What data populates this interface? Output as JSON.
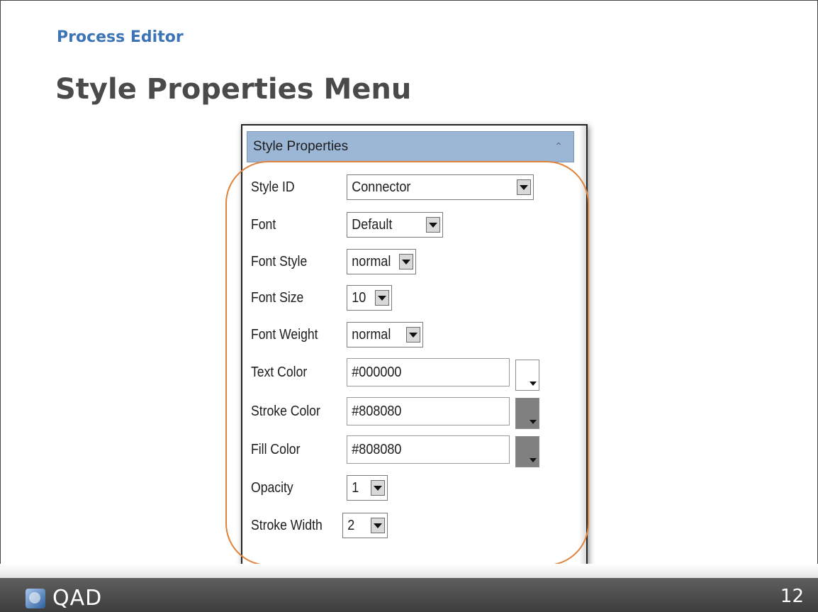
{
  "slide": {
    "kicker": "Process Editor",
    "title": "Style Properties Menu",
    "page_number": "12",
    "logo_text": "QAD"
  },
  "panel": {
    "header": "Style Properties",
    "fields": {
      "style_id": {
        "label": "Style ID",
        "value": "Connector"
      },
      "font": {
        "label": "Font",
        "value": "Default"
      },
      "font_style": {
        "label": "Font Style",
        "value": "normal"
      },
      "font_size": {
        "label": "Font Size",
        "value": "10"
      },
      "font_weight": {
        "label": "Font Weight",
        "value": "normal"
      },
      "text_color": {
        "label": "Text Color",
        "value": "#000000",
        "swatch": "#ffffff"
      },
      "stroke_color": {
        "label": "Stroke Color",
        "value": "#808080",
        "swatch": "#808080"
      },
      "fill_color": {
        "label": "Fill Color",
        "value": "#808080",
        "swatch": "#808080"
      },
      "opacity": {
        "label": "Opacity",
        "value": "1"
      },
      "stroke_width": {
        "label": "Stroke Width",
        "value": "2"
      }
    }
  },
  "colors": {
    "kicker": "#3d74b5",
    "highlight": "#e0823a",
    "panel_header": "#9cb6d6"
  }
}
